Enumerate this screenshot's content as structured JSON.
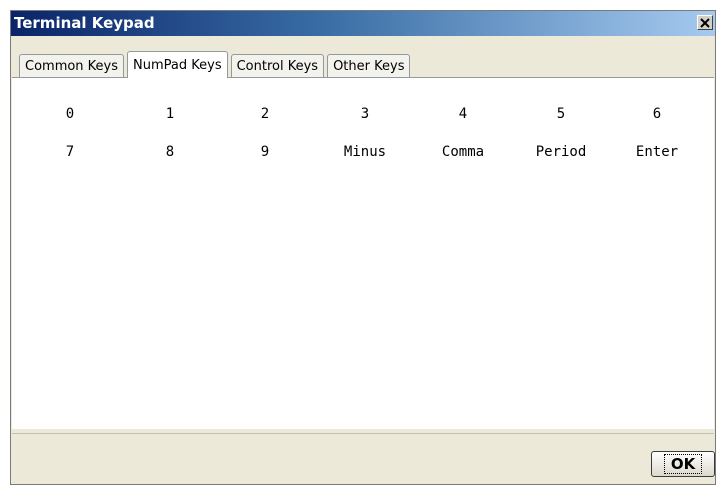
{
  "window": {
    "title": "Terminal Keypad",
    "close_label": "X"
  },
  "tabs": [
    {
      "label": "Common Keys",
      "active": false
    },
    {
      "label": "NumPad Keys",
      "active": true
    },
    {
      "label": "Control Keys",
      "active": false
    },
    {
      "label": "Other Keys",
      "active": false
    }
  ],
  "keypad": {
    "row1": [
      "0",
      "1",
      "2",
      "3",
      "4",
      "5",
      "6"
    ],
    "row2": [
      "7",
      "8",
      "9",
      "Minus",
      "Comma",
      "Period",
      "Enter"
    ]
  },
  "footer": {
    "ok_label": "OK"
  }
}
